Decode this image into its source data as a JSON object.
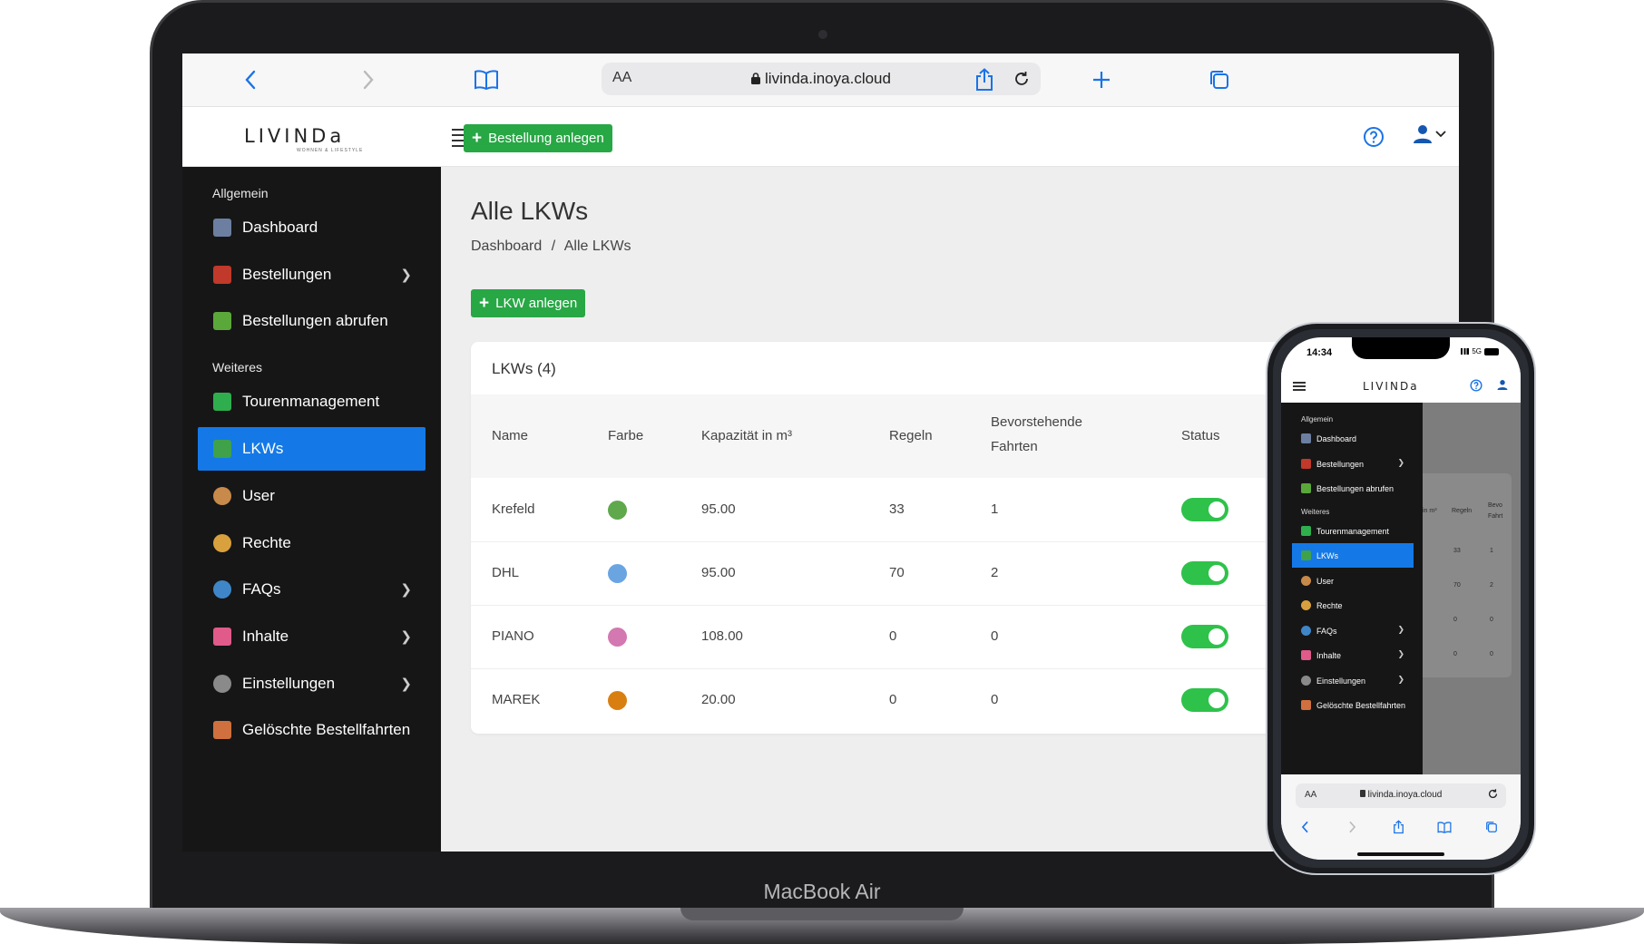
{
  "browser": {
    "address_aa": "AA",
    "url": "livinda.inoya.cloud"
  },
  "header": {
    "logo": "LIVINDa",
    "logo_sub": "WOHNEN & LIFESTYLE",
    "new_order_label": "Bestellung anlegen"
  },
  "sidebar": {
    "section_general": "Allgemein",
    "section_more": "Weiteres",
    "items": [
      {
        "label": "Dashboard",
        "icon": "dashboard-icon",
        "color": "#6c7fa1"
      },
      {
        "label": "Bestellungen",
        "icon": "orders-icon",
        "color": "#c0392b"
      },
      {
        "label": "Bestellungen abrufen",
        "icon": "shop-bag-icon",
        "color": "#5aa83a"
      },
      {
        "label": "Tourenmanagement",
        "icon": "map-icon",
        "color": "#2fae4e"
      },
      {
        "label": "LKWs",
        "icon": "truck-icon",
        "color": "#3fa14a"
      },
      {
        "label": "User",
        "icon": "user-avatar-icon",
        "color": "#c88a4a"
      },
      {
        "label": "Rechte",
        "icon": "rights-icon",
        "color": "#d9a13d"
      },
      {
        "label": "FAQs",
        "icon": "faq-icon",
        "color": "#3f86c8"
      },
      {
        "label": "Inhalte",
        "icon": "content-icon",
        "color": "#e05a8a"
      },
      {
        "label": "Einstellungen",
        "icon": "settings-icon",
        "color": "#8a8a8a"
      },
      {
        "label": "Gelöschte Bestellfahrten",
        "icon": "deleted-rides-icon",
        "color": "#d0703e"
      }
    ]
  },
  "main": {
    "title": "Alle LKWs",
    "breadcrumb_home": "Dashboard",
    "breadcrumb_sep": "/",
    "breadcrumb_current": "Alle LKWs",
    "add_truck_label": "LKW anlegen",
    "card_title": "LKWs (4)",
    "columns": [
      "Name",
      "Farbe",
      "Kapazität in m³",
      "Regeln",
      "Bevorstehende",
      "Fahrten",
      "Status"
    ],
    "rows": [
      {
        "name": "Krefeld",
        "color": "#5fa84c",
        "capacity": "95.00",
        "rules": "33",
        "rides": "1",
        "status": true
      },
      {
        "name": "DHL",
        "color": "#6aa5e2",
        "capacity": "95.00",
        "rules": "70",
        "rides": "2",
        "status": true
      },
      {
        "name": "PIANO",
        "color": "#d378b0",
        "capacity": "108.00",
        "rules": "0",
        "rides": "0",
        "status": true
      },
      {
        "name": "MAREK",
        "color": "#d97f12",
        "capacity": "20.00",
        "rules": "0",
        "rides": "0",
        "status": true
      }
    ]
  },
  "device": {
    "laptop_label": "MacBook Air",
    "phone_time": "14:34",
    "phone_signal": "5G"
  },
  "phone_main": {
    "col_capacity_partial": "in m³",
    "col_rules": "Regeln",
    "col_rides_1": "Bevo",
    "col_rides_2": "Fahrt",
    "rules": [
      "33",
      "70",
      "0",
      "0"
    ],
    "rides": [
      "1",
      "2",
      "0",
      "0"
    ]
  }
}
